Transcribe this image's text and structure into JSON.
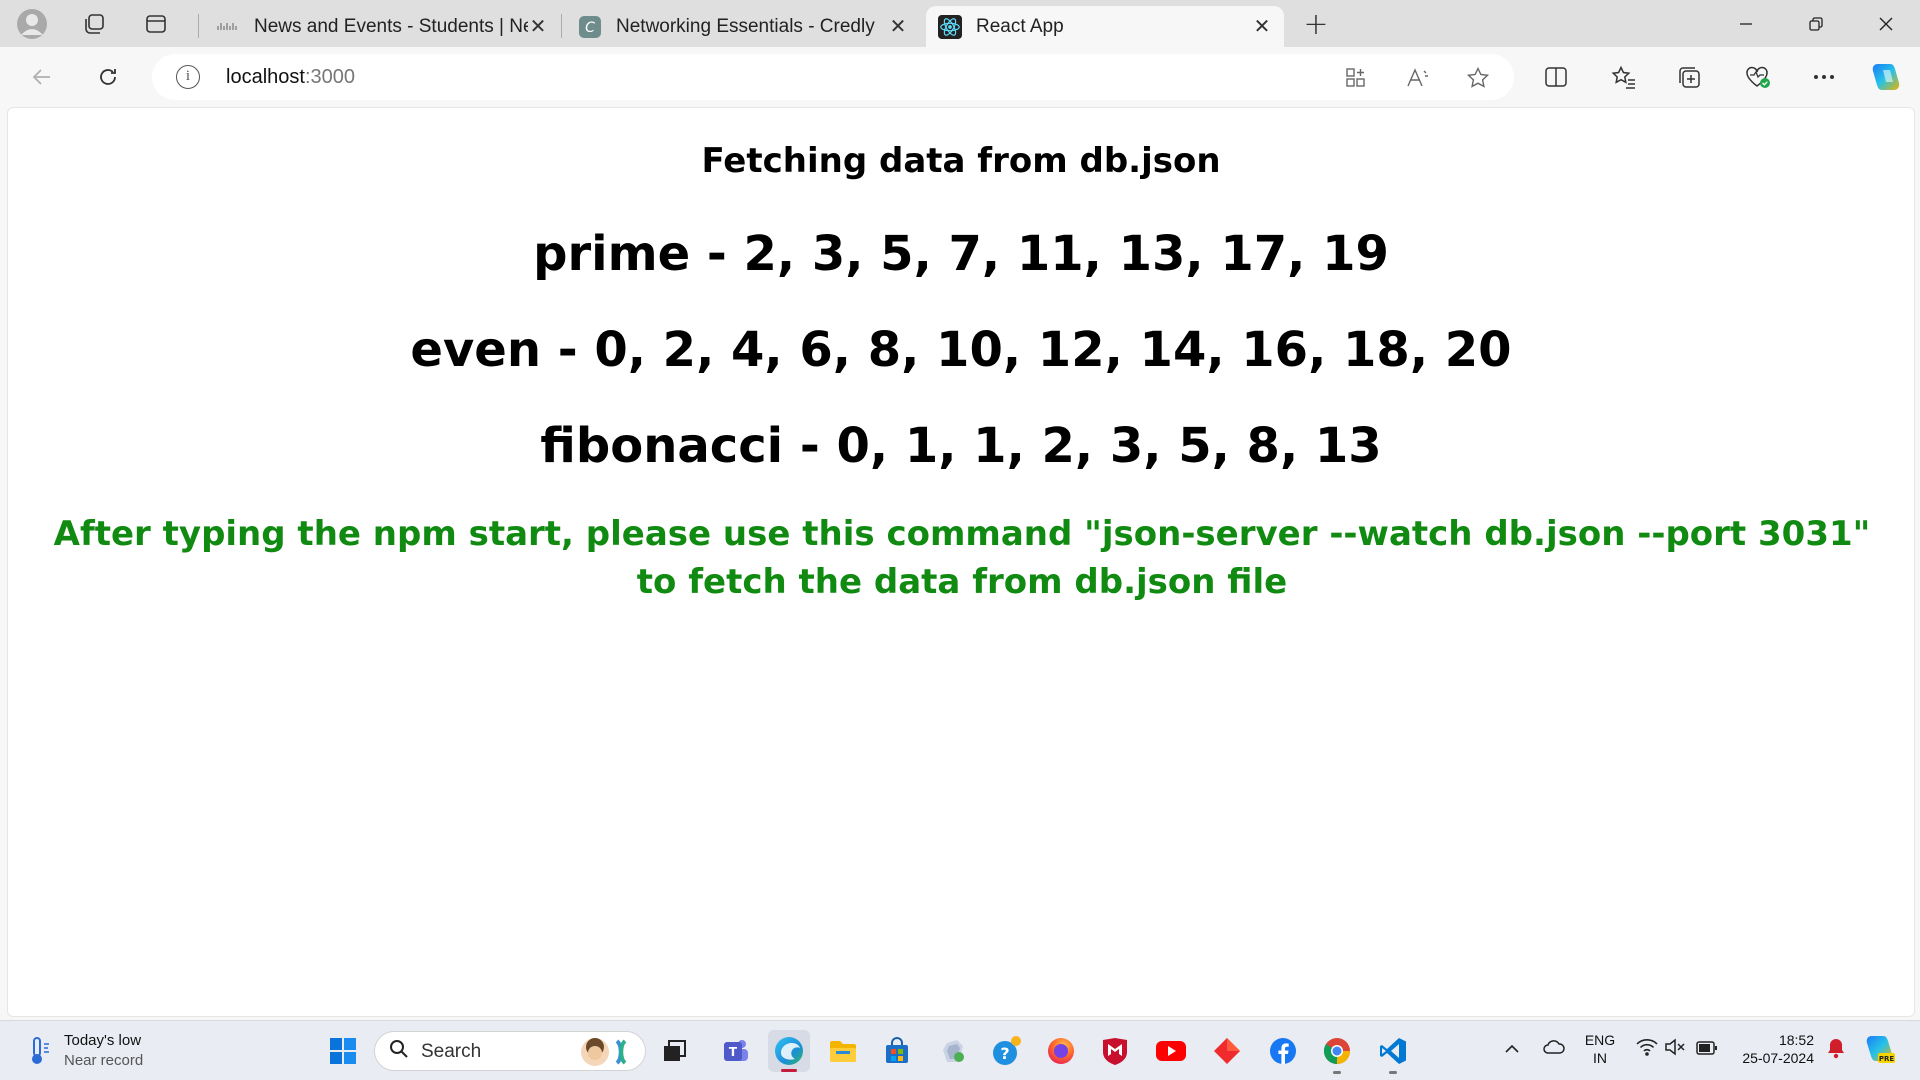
{
  "browser": {
    "tabs": [
      {
        "title": "News and Events - Students | Net",
        "favicon": "cisco-icon",
        "active": false
      },
      {
        "title": "Networking Essentials - Credly",
        "favicon": "credly-icon",
        "active": false
      },
      {
        "title": "React App",
        "favicon": "react-icon",
        "active": true
      }
    ],
    "address": {
      "host": "localhost",
      "port": ":3000"
    }
  },
  "page": {
    "title": "Fetching data from db.json",
    "lists": [
      {
        "text": "prime - 2, 3, 5, 7, 11, 13, 17, 19"
      },
      {
        "text": "even - 0, 2, 4, 6, 8, 10, 12, 14, 16, 18, 20"
      },
      {
        "text": "fibonacci - 0, 1, 1, 2, 3, 5, 8, 13"
      }
    ],
    "note": "After typing the npm start, please use this command \"json-server --watch db.json --port 3031\" to fetch the data from db.json file",
    "note_color": "#118a11"
  },
  "taskbar": {
    "weather": {
      "line1": "Today's low",
      "line2": "Near record"
    },
    "search_label": "Search",
    "tray": {
      "lang1": "ENG",
      "lang2": "IN",
      "time": "18:52",
      "date": "25-07-2024"
    }
  }
}
